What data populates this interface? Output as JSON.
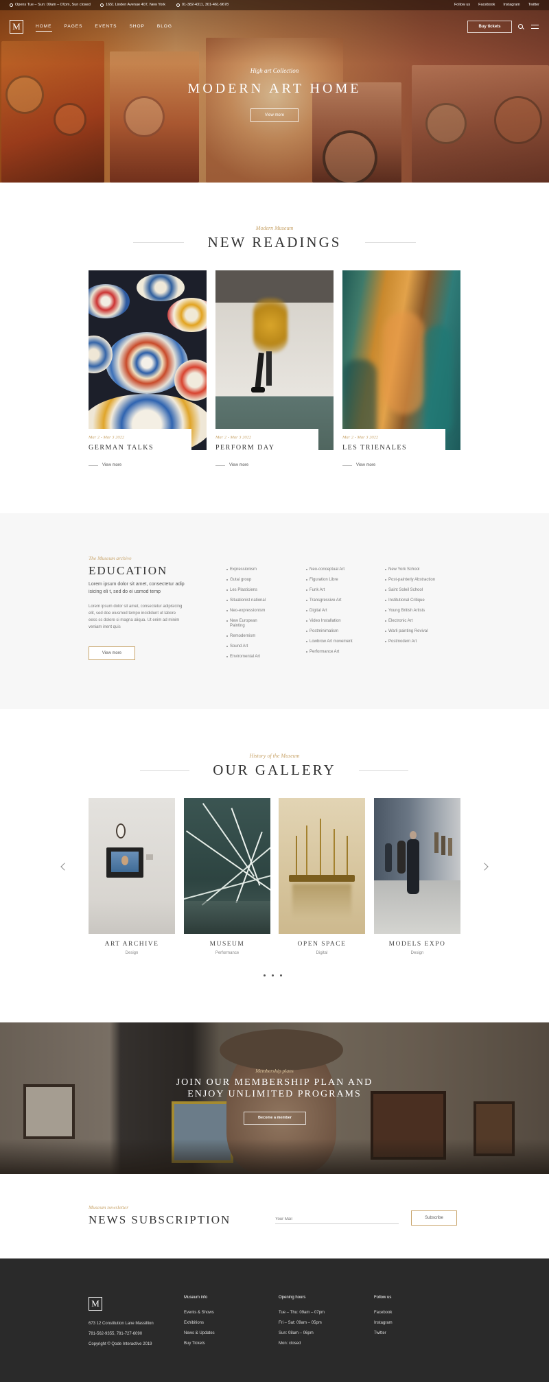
{
  "topbar": {
    "hours": "Opens Tue – Sun: 09am – 07pm, Sun closed",
    "address": "1651 Linden Avenue 407, New York",
    "phones": "01-382-4311, 301-461-9678",
    "social": [
      "Follow us",
      "Facebook",
      "Instagram",
      "Twitter"
    ]
  },
  "nav": {
    "logo": "M",
    "items": [
      "HOME",
      "PAGES",
      "EVENTS",
      "SHOP",
      "BLOG"
    ],
    "buy_tickets": "Buy tickets"
  },
  "hero": {
    "subtitle": "High art Collection",
    "title": "MODERN ART HOME",
    "button": "View more"
  },
  "readings": {
    "kicker": "Modern Museum",
    "title": "NEW READINGS",
    "items": [
      {
        "date": "Mar 2 - Mar 3 2022",
        "title": "GERMAN TALKS",
        "link": "View more"
      },
      {
        "date": "Mar 2 - Mar 3 2022",
        "title": "PERFORM DAY",
        "link": "View more"
      },
      {
        "date": "Mar 2 - Mar 3 2022",
        "title": "LES TRIENALES",
        "link": "View more"
      }
    ]
  },
  "education": {
    "kicker": "The Museum archive",
    "title": "EDUCATION",
    "lead": "Lorem ipsum dolor sit amet, consectetur adip isicing eli t, sed do ei usmod temp",
    "body": "Lorem ipsum dolor sit amet, consectetur adipisicing elit, sed doe eiusmod tempo incididunt ut labore eess ss dolore si magna aliqua. Ut enim ad minim veniam inent quis",
    "button": "View more",
    "list1": [
      "Expressionism",
      "Gutai group",
      "Les Plasticiens",
      "Situationist national",
      "Neo-expressionism",
      "New European Painting",
      "Remodernism",
      "Sound Art",
      "Enviromental Art"
    ],
    "list2": [
      "Neo-conceptual Art",
      "Figuration Libre",
      "Funk Art",
      "Transgressive Art",
      "Digital Art",
      "Video Installation",
      "Postminimalism",
      "Lowbrow Art movement",
      "Performance Art"
    ],
    "list3": [
      "New York School",
      "Post-painterly Abstraction",
      "Saint Soleil School",
      "Institutional Critique",
      "Young British Artists",
      "Electronic Art",
      "Warli painting Revival",
      "Postmodern Art"
    ]
  },
  "gallery": {
    "kicker": "History of the Museum",
    "title": "OUR GALLERY",
    "items": [
      {
        "title": "ART ARCHIVE",
        "subtitle": "Design"
      },
      {
        "title": "MUSEUM",
        "subtitle": "Performance"
      },
      {
        "title": "OPEN SPACE",
        "subtitle": "Digital"
      },
      {
        "title": "MODELS EXPO",
        "subtitle": "Design"
      }
    ]
  },
  "membership": {
    "kicker": "Membership plans",
    "title_line1": "JOIN OUR MEMBERSHIP PLAN AND",
    "title_line2": "ENJOY UNLIMITED PROGRAMS",
    "button": "Become a member"
  },
  "newsletter": {
    "kicker": "Museum newsletter",
    "title": "NEWS SUBSCRIPTION",
    "placeholder": "Your Mail",
    "button": "Subscribe"
  },
  "footer": {
    "logo": "M",
    "address": "673 12 Constitution Lane Massillion",
    "phones": "781-562-9355, 781-727-6090",
    "copyright": "Copyright © Qode Interactive 2019",
    "col1": {
      "heading": "Museum info",
      "links": [
        "Events & Shows",
        "Exhibitions",
        "News & Updates",
        "Buy Tickets"
      ]
    },
    "col2": {
      "heading": "Opening hours",
      "lines": [
        "Tue – Thu: 09am – 07pm",
        "Fri – Sat: 09am – 05pm",
        "Sun: 08am – 06pm",
        "Mon: closed"
      ]
    },
    "col3": {
      "heading": "Follow us",
      "links": [
        "Facebook",
        "Instagram",
        "Twitter"
      ]
    }
  }
}
